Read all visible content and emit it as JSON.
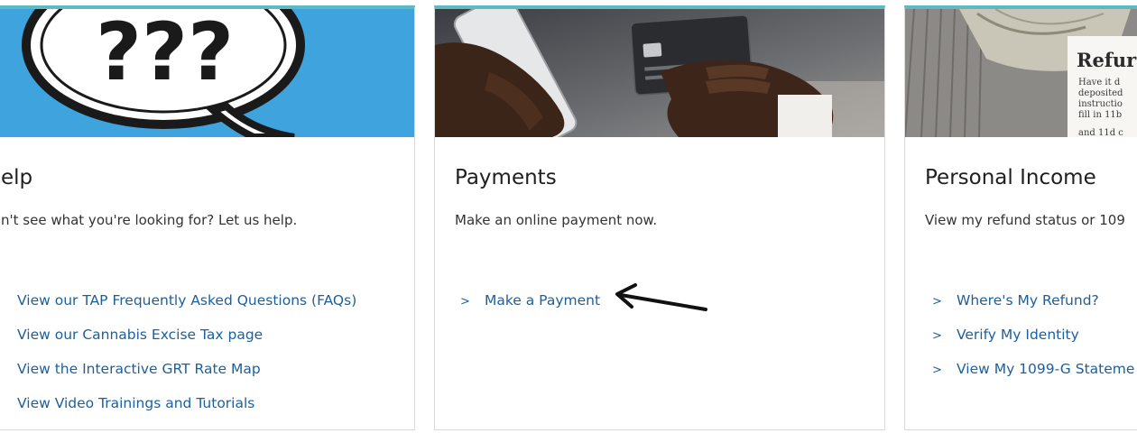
{
  "cards": {
    "help": {
      "title": "elp",
      "description": "n't see what you're looking for? Let us help.",
      "image_text": "???",
      "links": [
        "View our TAP Frequently Asked Questions (FAQs)",
        "View our Cannabis Excise Tax page",
        "View the Interactive GRT Rate Map",
        "View Video Trainings and Tutorials"
      ]
    },
    "payments": {
      "title": "Payments",
      "description": "Make an online payment now.",
      "links": [
        "Make a Payment"
      ]
    },
    "income": {
      "title": "Personal Income",
      "description": "View my refund status or 109",
      "image_text": {
        "heading": "Refur",
        "lines": [
          "Have it d",
          "deposited",
          "instructio",
          "fill in 11b",
          "and 11d c"
        ]
      },
      "links": [
        "Where's My Refund?",
        "Verify My Identity",
        "View My 1099-G Stateme"
      ]
    }
  },
  "icons": {
    "link_chevron": ">"
  },
  "colors": {
    "accent": "#5fb9c2",
    "link": "#1d5f9c",
    "help_bg": "#3ea2dc"
  }
}
